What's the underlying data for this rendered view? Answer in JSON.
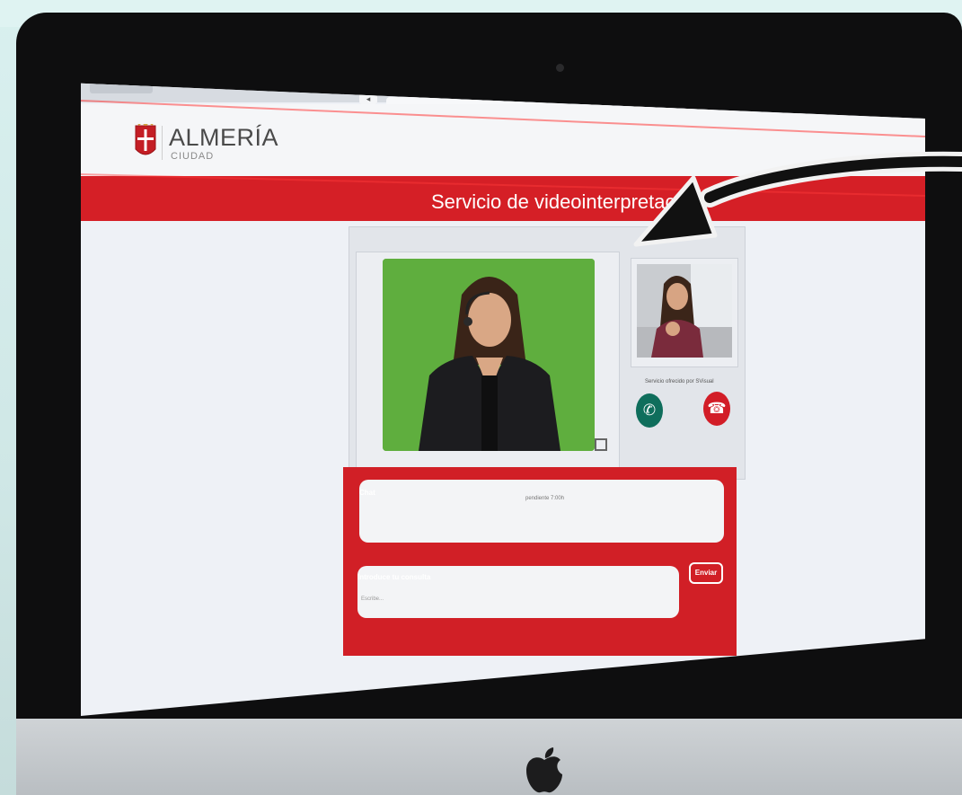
{
  "header": {
    "brand_name": "ALMERÍA",
    "brand_sub": "CIUDAD"
  },
  "banner": {
    "title": "Servicio de videointerpretación"
  },
  "video": {
    "service_note": "Servicio ofrecido por SVisual"
  },
  "chat": {
    "label": "Chat",
    "message": "pendiente 7:00h",
    "query_label": "Introduce tu consulta",
    "query_placeholder": "Escribe...",
    "send_label": "Enviar"
  },
  "colors": {
    "brand_red": "#d51f26",
    "call_green": "#0f6e5c",
    "hangup_red": "#d21d27",
    "chroma_green": "#5fae3e"
  },
  "icons": {
    "call": "phone-icon",
    "hangup": "phone-hangup-icon",
    "expand": "expand-icon",
    "apple": "apple-logo-icon"
  }
}
